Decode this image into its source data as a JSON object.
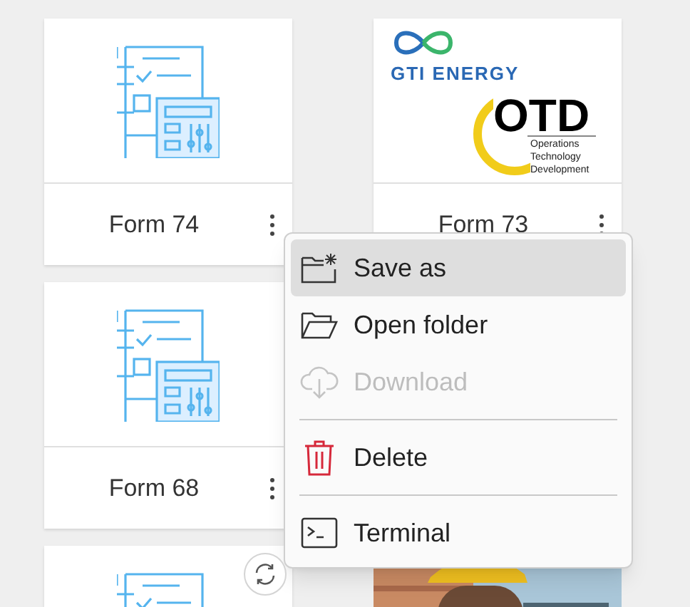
{
  "card_rows": [
    [
      {
        "kind": "form",
        "title": "Form 74"
      },
      {
        "kind": "logo",
        "title": "Form 73",
        "logo": {
          "brand": "GTI ENERGY",
          "mark": "OTD",
          "tagline": [
            "Operations",
            "Technology",
            "Development"
          ]
        }
      }
    ],
    [
      {
        "kind": "form",
        "title": "Form 68"
      }
    ],
    [
      {
        "kind": "form"
      },
      {
        "kind": "picture"
      }
    ]
  ],
  "context_menu": {
    "items": [
      {
        "kind": "save-as",
        "label": "Save as",
        "selected": true,
        "disabled": false
      },
      {
        "kind": "open-folder",
        "label": "Open folder",
        "selected": false,
        "disabled": false
      },
      {
        "kind": "download",
        "label": "Download",
        "selected": false,
        "disabled": true
      },
      {
        "kind": "separator"
      },
      {
        "kind": "delete",
        "label": "Delete",
        "selected": false,
        "disabled": false
      },
      {
        "kind": "separator"
      },
      {
        "kind": "terminal",
        "label": "Terminal",
        "selected": false,
        "disabled": false
      }
    ]
  }
}
